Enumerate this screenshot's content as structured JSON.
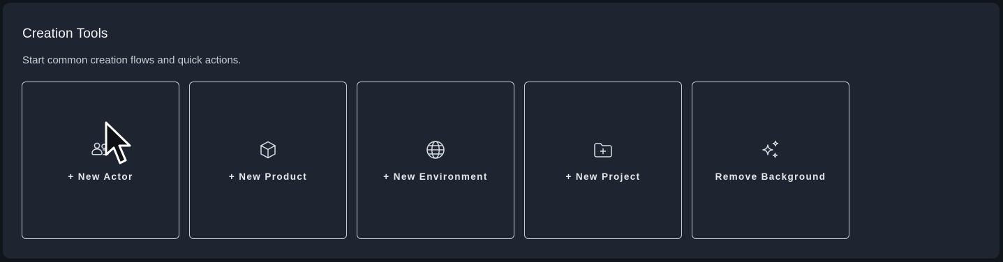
{
  "section": {
    "title": "Creation Tools",
    "subtitle": "Start common creation flows and quick actions."
  },
  "cards": [
    {
      "label": "+ New Actor",
      "icon": "users-icon"
    },
    {
      "label": "+ New Product",
      "icon": "cube-icon"
    },
    {
      "label": "+ New Environment",
      "icon": "globe-icon"
    },
    {
      "label": "+ New Project",
      "icon": "folder-plus-icon"
    },
    {
      "label": "Remove Background",
      "icon": "sparkles-icon"
    }
  ],
  "colors": {
    "background": "#10141b",
    "panel": "#1e2430",
    "card_border": "#c7ccd4",
    "text": "#f1f3f6"
  }
}
